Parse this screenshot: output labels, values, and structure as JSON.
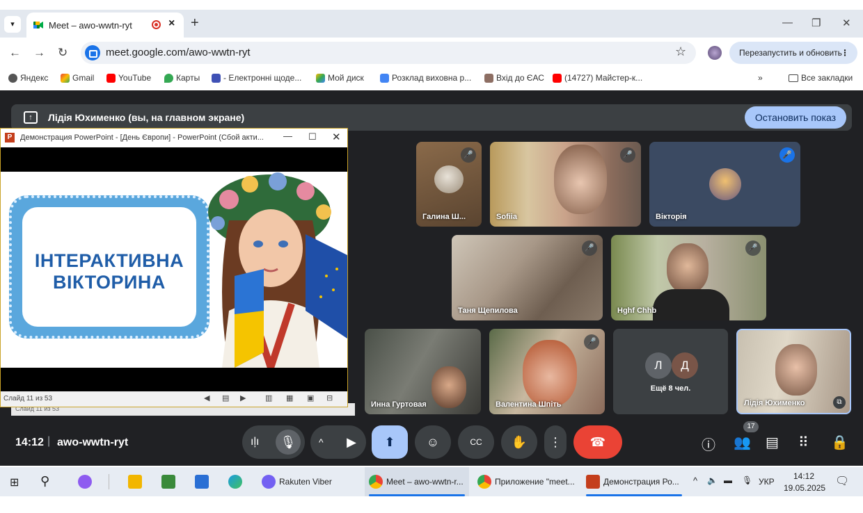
{
  "browser": {
    "tab_title": "Meet – awo-wwtn-ryt",
    "new_tab_label": "+",
    "url": "meet.google.com/awo-wwtn-ryt",
    "relaunch_label": "Перезапустить и обновить",
    "bookmarks": [
      "Яндекс",
      "Gmail",
      "YouTube",
      "Карты",
      "- Електронні щоде...",
      "Мой диск",
      "Розклад виховна р...",
      "Вхід до ЄАС",
      "(14727) Майстер-к..."
    ],
    "overflow": "»",
    "all_bookmarks": "Все закладки"
  },
  "meet": {
    "banner_title": "Лідія Юхименко (вы, на главном экране)",
    "stop_label": "Остановить показ",
    "participants": [
      {
        "name": "Галина Ш...",
        "muted": true
      },
      {
        "name": "Sofiia",
        "muted": true
      },
      {
        "name": "Вікторія",
        "muted": true
      },
      {
        "name": "Таня Щепилова",
        "muted": true
      },
      {
        "name": "Hghf Chhb",
        "muted": true
      },
      {
        "name": "Инна Гуртовая",
        "muted": false
      },
      {
        "name": "Валентина Шпіть",
        "muted": true
      },
      {
        "name": "Лідія Юхименко",
        "muted": false
      }
    ],
    "more_initials": [
      "Л",
      "Д"
    ],
    "more_label": "Ещё 8 чел.",
    "time": "14:12",
    "separator": "|",
    "meeting_code": "awo-wwtn-ryt",
    "people_count": "17"
  },
  "powerpoint": {
    "window_title": "Демонстрация PowerPoint - [День Європи] - PowerPoint (Сбой акти...",
    "slide_text_line1": "ІНТЕРАКТИВНА",
    "slide_text_line2": "ВІКТОРИНА",
    "slide_status": "Слайд 11 из 53",
    "status_behind": "Слайд 11 из 53"
  },
  "taskbar": {
    "apps": [
      "Rakuten Viber",
      "Meet – awo-wwtn-r...",
      "Приложение \"meet...",
      "Демонстрация Ро..."
    ],
    "lang": "УКР",
    "time": "14:12",
    "date": "19.05.2025"
  },
  "colors": {
    "meet_bg": "#202124",
    "tile": "#3c4043",
    "stop_btn": "#a8c7fa",
    "hangup": "#ea4335",
    "present_active": "#a8c7fa",
    "slide_blue": "#1f5da8"
  }
}
